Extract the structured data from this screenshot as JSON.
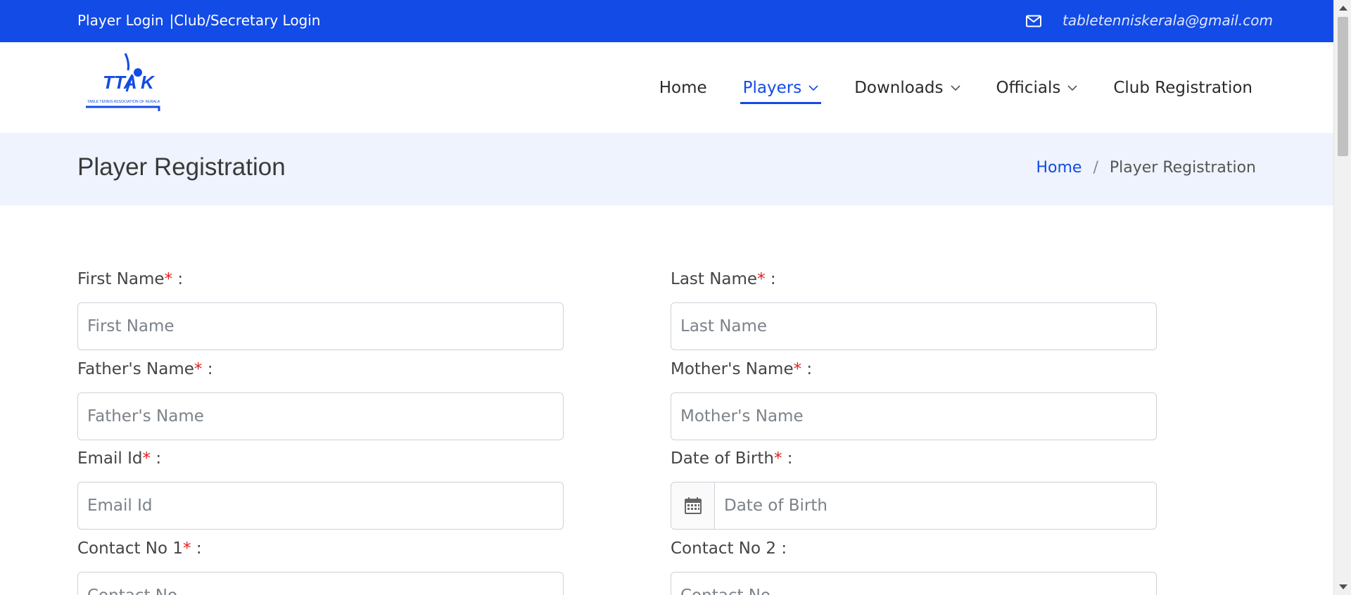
{
  "topbar": {
    "player_login": "Player Login",
    "club_login": "|Club/Secretary Login",
    "email": "tabletenniskerala@gmail.com",
    "bg_color": "#124be6"
  },
  "logo": {
    "text": "TTAK",
    "subtext": "TABLE TENNIS ASSOCIATION OF KERALA"
  },
  "nav": {
    "items": [
      {
        "label": "Home",
        "active": false,
        "dropdown": false
      },
      {
        "label": "Players",
        "active": true,
        "dropdown": true
      },
      {
        "label": "Downloads",
        "active": false,
        "dropdown": true
      },
      {
        "label": "Officials",
        "active": false,
        "dropdown": true
      },
      {
        "label": "Club Registration",
        "active": false,
        "dropdown": false
      }
    ]
  },
  "page": {
    "title": "Player Registration",
    "breadcrumb_home": "Home",
    "breadcrumb_sep": "/",
    "breadcrumb_current": "Player Registration"
  },
  "form": {
    "first_name": {
      "label": "First Name",
      "required": "*",
      "suffix": " :",
      "placeholder": "First Name"
    },
    "last_name": {
      "label": "Last Name",
      "required": "*",
      "suffix": " :",
      "placeholder": "Last Name"
    },
    "father_name": {
      "label": "Father's Name",
      "required": "*",
      "suffix": " :",
      "placeholder": "Father's Name"
    },
    "mother_name": {
      "label": "Mother's Name",
      "required": "*",
      "suffix": " :",
      "placeholder": "Mother's Name"
    },
    "email": {
      "label": "Email Id",
      "required": "*",
      "suffix": " :",
      "placeholder": "Email Id"
    },
    "dob": {
      "label": "Date of Birth",
      "required": "*",
      "suffix": " :",
      "placeholder": "Date of Birth",
      "icon": "calendar-icon"
    },
    "contact1": {
      "label": "Contact No 1",
      "required": "*",
      "suffix": " :",
      "placeholder": "Contact No"
    },
    "contact2": {
      "label": "Contact No 2 :",
      "placeholder": "Contact No"
    }
  }
}
